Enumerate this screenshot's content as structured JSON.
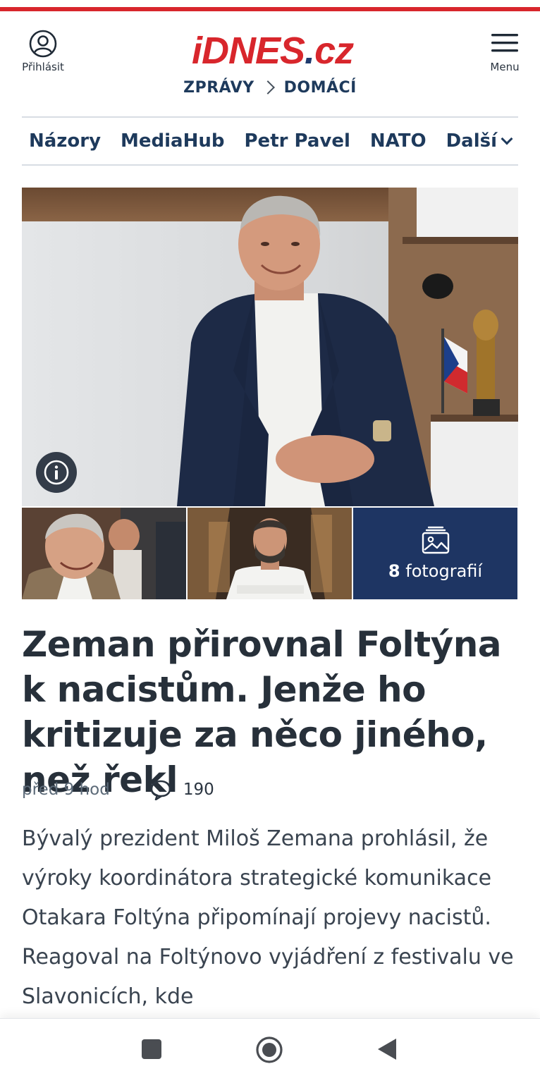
{
  "header": {
    "login_label": "Přihlásit",
    "logo_main": "iDNES",
    "logo_dot": ".",
    "logo_tld": "cz",
    "menu_label": "Menu"
  },
  "breadcrumb": [
    "ZPRÁVY",
    "DOMÁCÍ"
  ],
  "nav": {
    "items": [
      "Názory",
      "MediaHub",
      "Petr Pavel",
      "NATO"
    ],
    "more": "Další"
  },
  "gallery": {
    "count": "8",
    "count_label": "fotografií"
  },
  "article": {
    "title": "Zeman přirovnal Foltýna k nacistům. Jenže ho kritizuje za něco jiného, než řekl",
    "time": "před 9 hod",
    "comments": "190",
    "perex": "Bývalý prezident Miloš Zemana prohlásil, že výroky koordinátora strategické komunikace Otakara Foltýna připomínají projevy nacistů. Reagoval na Foltýnovo vyjádření z festivalu ve Slavonicích, kde"
  },
  "colors": {
    "brand_red": "#d8262c",
    "navy": "#1e3a5c",
    "gallery_tile": "#1e3563"
  }
}
